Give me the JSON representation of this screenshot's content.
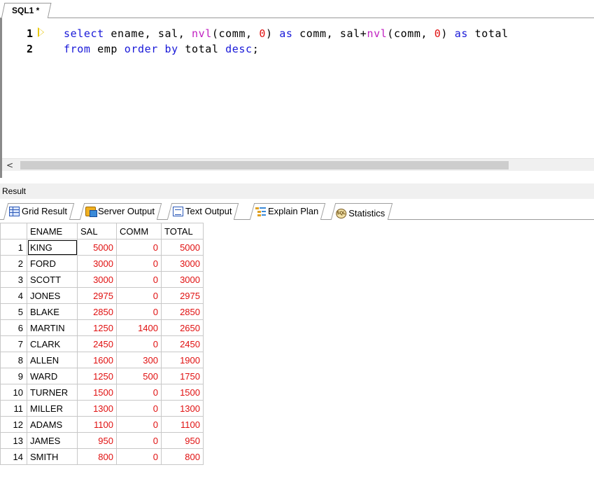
{
  "editor_tab": {
    "label": "SQL1 *"
  },
  "editor": {
    "line_numbers": [
      "1",
      "2"
    ],
    "line1": {
      "t1": "select",
      "t2": " ename, sal, ",
      "t3": "nvl",
      "t4": "(comm, ",
      "t5": "0",
      "t6": ") ",
      "t7": "as",
      "t8": " comm, sal+",
      "t9": "nvl",
      "t10": "(comm, ",
      "t11": "0",
      "t12": ") ",
      "t13": "as",
      "t14": " total"
    },
    "line2": {
      "t1": "from",
      "t2": " emp ",
      "t3": "order by",
      "t4": " total ",
      "t5": "desc",
      "t6": ";"
    },
    "scroll_left_glyph": "<"
  },
  "result_panel": {
    "title": "Result"
  },
  "result_tabs": [
    {
      "label": "Grid Result",
      "icon": "grid-icon"
    },
    {
      "label": "Server Output",
      "icon": "server-output-icon"
    },
    {
      "label": "Text Output",
      "icon": "text-output-icon"
    },
    {
      "label": "Explain Plan",
      "icon": "explain-plan-icon"
    },
    {
      "label": "Statistics",
      "icon": "statistics-icon"
    }
  ],
  "grid": {
    "columns": [
      "ENAME",
      "SAL",
      "COMM",
      "TOTAL"
    ],
    "rows": [
      {
        "n": "1",
        "ename": "KING",
        "sal": "5000",
        "comm": "0",
        "total": "5000"
      },
      {
        "n": "2",
        "ename": "FORD",
        "sal": "3000",
        "comm": "0",
        "total": "3000"
      },
      {
        "n": "3",
        "ename": "SCOTT",
        "sal": "3000",
        "comm": "0",
        "total": "3000"
      },
      {
        "n": "4",
        "ename": "JONES",
        "sal": "2975",
        "comm": "0",
        "total": "2975"
      },
      {
        "n": "5",
        "ename": "BLAKE",
        "sal": "2850",
        "comm": "0",
        "total": "2850"
      },
      {
        "n": "6",
        "ename": "MARTIN",
        "sal": "1250",
        "comm": "1400",
        "total": "2650"
      },
      {
        "n": "7",
        "ename": "CLARK",
        "sal": "2450",
        "comm": "0",
        "total": "2450"
      },
      {
        "n": "8",
        "ename": "ALLEN",
        "sal": "1600",
        "comm": "300",
        "total": "1900"
      },
      {
        "n": "9",
        "ename": "WARD",
        "sal": "1250",
        "comm": "500",
        "total": "1750"
      },
      {
        "n": "10",
        "ename": "TURNER",
        "sal": "1500",
        "comm": "0",
        "total": "1500"
      },
      {
        "n": "11",
        "ename": "MILLER",
        "sal": "1300",
        "comm": "0",
        "total": "1300"
      },
      {
        "n": "12",
        "ename": "ADAMS",
        "sal": "1100",
        "comm": "0",
        "total": "1100"
      },
      {
        "n": "13",
        "ename": "JAMES",
        "sal": "950",
        "comm": "0",
        "total": "950"
      },
      {
        "n": "14",
        "ename": "SMITH",
        "sal": "800",
        "comm": "0",
        "total": "800"
      }
    ]
  },
  "colors": {
    "keyword": "#1818d8",
    "function": "#c020c0",
    "number": "#e01010",
    "marker": "#e8c80a"
  }
}
